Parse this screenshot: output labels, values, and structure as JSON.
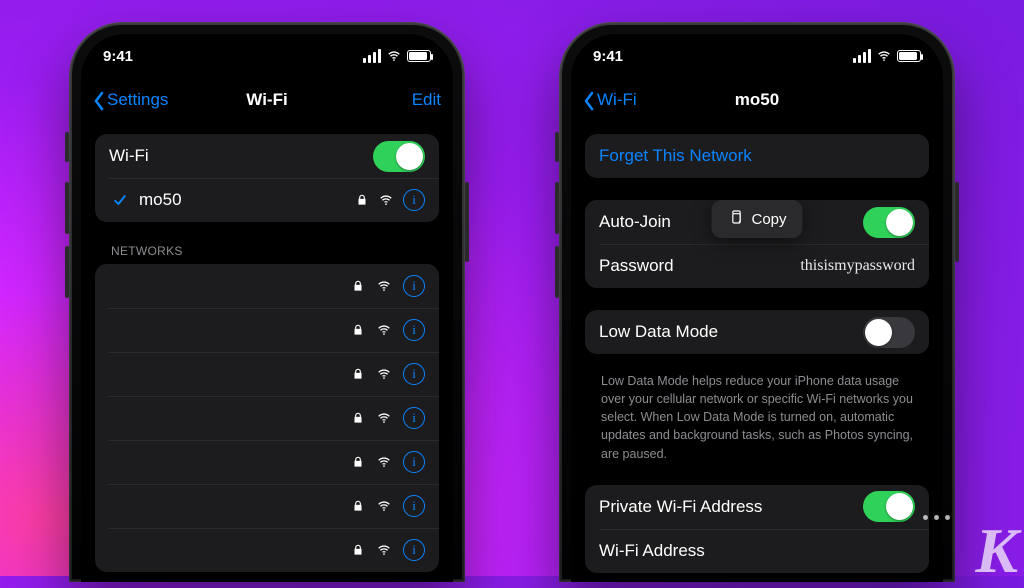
{
  "status": {
    "time": "9:41"
  },
  "colors": {
    "tint": "#0a84ff",
    "switchOn": "#30d158"
  },
  "left": {
    "nav": {
      "back": "Settings",
      "title": "Wi-Fi",
      "action": "Edit"
    },
    "wifi": {
      "toggle_label": "Wi-Fi",
      "toggle_on": true,
      "connected": {
        "name": "mo50",
        "secured": true
      }
    },
    "section_networks": "NETWORKS",
    "networks_placeholder_rows": 7
  },
  "right": {
    "nav": {
      "back": "Wi-Fi",
      "title": "mo50"
    },
    "forget_label": "Forget This Network",
    "auto_join": {
      "label": "Auto-Join",
      "on": true
    },
    "password": {
      "label": "Password",
      "value": "thisismypassword",
      "copy_label": "Copy"
    },
    "low_data": {
      "label": "Low Data Mode",
      "on": false,
      "footer": "Low Data Mode helps reduce your iPhone data usage over your cellular network or specific Wi-Fi networks you select. When Low Data Mode is turned on, automatic updates and background tasks, such as Photos syncing, are paused."
    },
    "private_addr": {
      "label": "Private Wi-Fi Address",
      "on": true
    },
    "wifi_addr_label": "Wi-Fi Address"
  }
}
